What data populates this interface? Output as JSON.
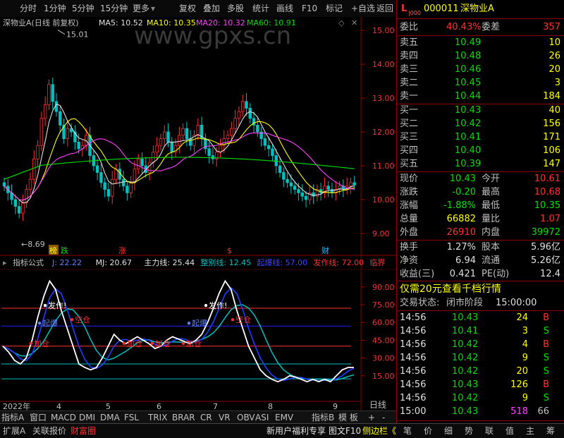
{
  "toolbar": {
    "left": [
      "分时",
      "1分钟",
      "5分钟",
      "15分钟",
      "更多"
    ],
    "right": [
      "复权",
      "叠加",
      "多股",
      "统计",
      "画线",
      "F10",
      "+自选",
      "返回"
    ]
  },
  "legend": {
    "title": "深物业A(日线 前复权)",
    "ma5": "MA5: 10.52",
    "ma10": "MA10: 10.35",
    "ma20": "MA20: 10.32",
    "ma60": "MA60: 10.91"
  },
  "watermark": "www.gpxs.cn",
  "chart_data": {
    "type": "candlestick",
    "price_axis": [
      "15.00",
      "14.00",
      "13.00",
      "12.00",
      "11.00",
      "10.00",
      "9.00"
    ],
    "high_label": "15.01",
    "low_label": "8.69",
    "markers": [
      "榜",
      "跌",
      "涨",
      "$",
      "财"
    ],
    "indicator": {
      "name": "指标公式",
      "values": [
        {
          "k": "J",
          "v": "22.22"
        },
        {
          "k": "MJ",
          "v": "20.67"
        },
        {
          "k": "主力线",
          "v": "25.44"
        },
        {
          "k": "整别线",
          "v": "12.45"
        },
        {
          "k": "起爆线",
          "v": "57.00"
        },
        {
          "k": "发作线",
          "v": "72.00"
        },
        {
          "k": "临界",
          "v": ""
        }
      ],
      "axis": [
        "90.00",
        "75.00",
        "60.00",
        "45.00",
        "30.00",
        "15.00"
      ],
      "annotations": [
        "发作!",
        "空仓",
        "起爆",
        "加仓",
        "加仓",
        "加仓",
        "加仓",
        "发作!",
        "起爆",
        "空仓"
      ]
    },
    "x_axis": [
      "2022年",
      "4",
      "5",
      "6",
      "7",
      "8",
      "9"
    ]
  },
  "tabs": [
    "指标A",
    "窗口",
    "MACD",
    "DMI",
    "DMA",
    "FSL",
    "TRIX",
    "BRAR",
    "CR",
    "VR",
    "OBV",
    "ASI",
    "EMV",
    "指标B",
    "模 板",
    "+",
    "-",
    "日线"
  ],
  "quote": {
    "code": "000011",
    "name": "深物业A",
    "weibi_label": "委比",
    "weibi": "40.43%",
    "weicha_label": "委差",
    "weicha": "357",
    "asks": [
      {
        "label": "卖五",
        "price": "10.49",
        "vol": "10"
      },
      {
        "label": "卖四",
        "price": "10.48",
        "vol": "26"
      },
      {
        "label": "卖三",
        "price": "10.46",
        "vol": "20"
      },
      {
        "label": "卖二",
        "price": "10.45",
        "vol": "3"
      },
      {
        "label": "卖一",
        "price": "10.44",
        "vol": "184"
      }
    ],
    "bids": [
      {
        "label": "买一",
        "price": "10.43",
        "vol": "40"
      },
      {
        "label": "买二",
        "price": "10.42",
        "vol": "156"
      },
      {
        "label": "买三",
        "price": "10.41",
        "vol": "171"
      },
      {
        "label": "买四",
        "price": "10.40",
        "vol": "106"
      },
      {
        "label": "买五",
        "price": "10.39",
        "vol": "147"
      }
    ],
    "stats": [
      {
        "l1": "现价",
        "v1": "10.43",
        "c1": "green",
        "l2": "今开",
        "v2": "10.61",
        "c2": "red"
      },
      {
        "l1": "涨跌",
        "v1": "-0.20",
        "c1": "green",
        "l2": "最高",
        "v2": "10.68",
        "c2": "red"
      },
      {
        "l1": "涨幅",
        "v1": "-1.88%",
        "c1": "green",
        "l2": "最低",
        "v2": "10.35",
        "c2": "green"
      },
      {
        "l1": "总量",
        "v1": "66882",
        "c1": "yel",
        "l2": "量比",
        "v2": "1.07",
        "c2": "red"
      },
      {
        "l1": "外盘",
        "v1": "26910",
        "c1": "red",
        "l2": "内盘",
        "v2": "39972",
        "c2": "green"
      }
    ],
    "stats2": [
      {
        "l1": "换手",
        "v1": "1.27%",
        "l2": "股本",
        "v2": "5.96亿"
      },
      {
        "l1": "净资",
        "v1": "6.94",
        "l2": "流通",
        "v2": "5.26亿"
      },
      {
        "l1": "收益(三)",
        "v1": "0.421",
        "l2": "PE(动)",
        "v2": "12.4"
      }
    ],
    "promo": "仅需20元查看千档行情",
    "trade_state_label": "交易状态:",
    "trade_state": "闭市阶段",
    "trade_time": "15:00:00",
    "ticks": [
      {
        "t": "14:56",
        "p": "10.43",
        "v": "24",
        "d": "B"
      },
      {
        "t": "14:56",
        "p": "10.41",
        "v": "3",
        "d": "S"
      },
      {
        "t": "14:56",
        "p": "10.42",
        "v": "4",
        "d": "B"
      },
      {
        "t": "14:56",
        "p": "10.42",
        "v": "9",
        "d": "S"
      },
      {
        "t": "14:56",
        "p": "10.42",
        "v": "20",
        "d": "S"
      },
      {
        "t": "14:56",
        "p": "10.43",
        "v": "126",
        "d": "B"
      },
      {
        "t": "14:56",
        "p": "10.42",
        "v": "9",
        "d": "S"
      },
      {
        "t": "15:00",
        "p": "10.43",
        "v": "518",
        "d": "66"
      }
    ],
    "side_tabs": [
      "笔",
      "价",
      "细",
      "势",
      "联",
      "值",
      "主",
      "筹"
    ]
  },
  "status": {
    "left": [
      "扩展A",
      "关联报价",
      "财富圈"
    ],
    "right": [
      "新用户福利专享",
      "图文F10",
      "侧边栏《"
    ]
  }
}
